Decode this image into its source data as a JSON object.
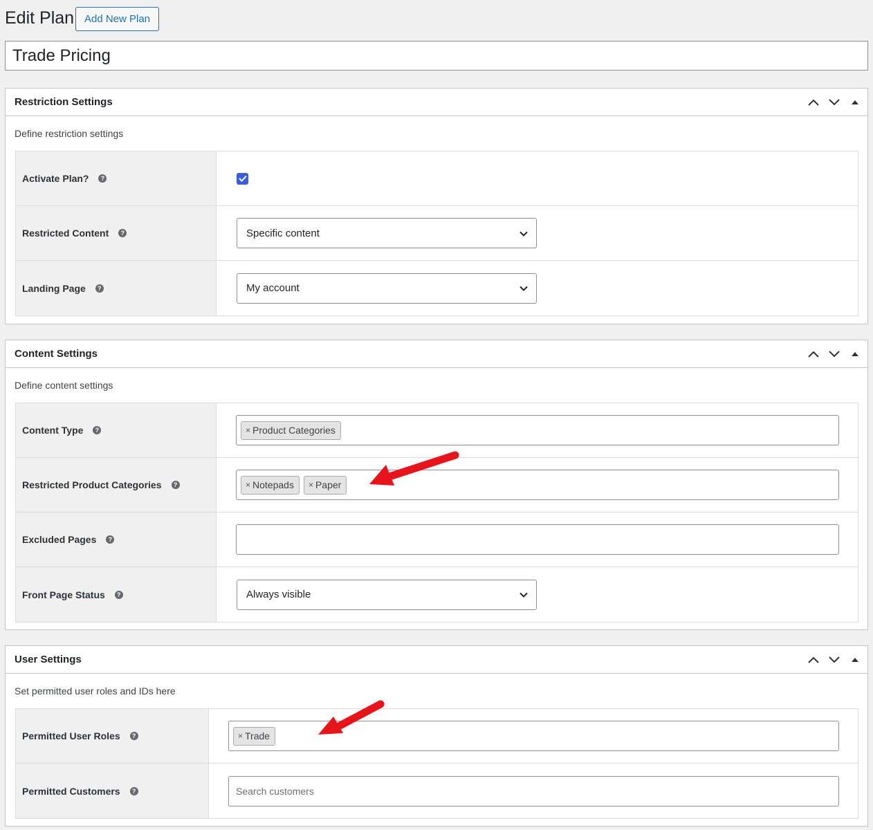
{
  "header": {
    "title": "Edit Plan",
    "add_new_label": "Add New Plan",
    "plan_name": "Trade Pricing"
  },
  "restriction": {
    "title": "Restriction Settings",
    "description": "Define restriction settings",
    "rows": [
      {
        "label": "Activate Plan?",
        "checked": true
      },
      {
        "label": "Restricted Content",
        "value": "Specific content"
      },
      {
        "label": "Landing Page",
        "value": "My account"
      }
    ]
  },
  "content": {
    "title": "Content Settings",
    "description": "Define content settings",
    "rows": [
      {
        "label": "Content Type",
        "tags": [
          "Product Categories"
        ]
      },
      {
        "label": "Restricted Product Categories",
        "tags": [
          "Notepads",
          "Paper"
        ]
      },
      {
        "label": "Excluded Pages",
        "value": ""
      },
      {
        "label": "Front Page Status",
        "value": "Always visible"
      }
    ]
  },
  "user": {
    "title": "User Settings",
    "description": "Set permitted user roles and IDs here",
    "rows": [
      {
        "label": "Permitted User Roles",
        "tags": [
          "Trade"
        ]
      },
      {
        "label": "Permitted Customers",
        "placeholder": "Search customers"
      }
    ]
  },
  "icons": {
    "help": "help-icon",
    "move_up": "chevron-up-icon",
    "move_down": "chevron-down-icon",
    "toggle": "triangle-up-icon",
    "dropdown": "chevron-down-icon",
    "remove": "x-icon"
  },
  "colors": {
    "accent": "#2271b1",
    "checkbox": "#3a5fd9",
    "annotation_arrow": "#e8141b"
  },
  "tag_remove_glyph": "×",
  "help_glyph": "?"
}
